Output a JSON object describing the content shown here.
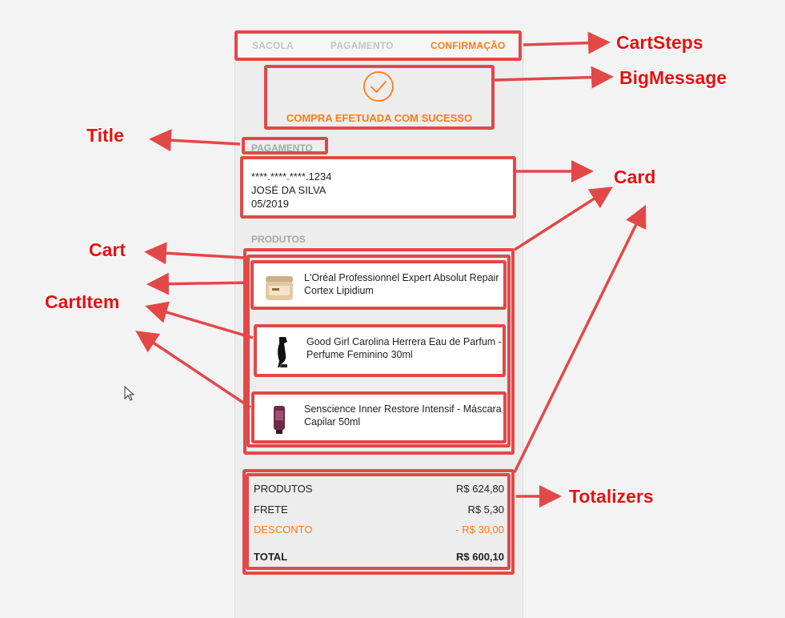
{
  "steps": {
    "sacola": "SACOLA",
    "pagamento": "PAGAMENTO",
    "confirmacao": "CONFIRMAÇÃO"
  },
  "big_message": {
    "icon": "check-circle-icon",
    "text": "COMPRA EFETUADA COM SUCESSO"
  },
  "payment": {
    "title": "PAGAMENTO",
    "card_number": "****.****.****.1234",
    "holder": "JOSÉ DA SILVA",
    "expiry": "05/2019"
  },
  "products": {
    "title": "PRODUTOS",
    "items": [
      {
        "name": "L'Oréal Professionnel Expert Absolut Repair Cortex Lipidium",
        "icon": "cream-jar-icon"
      },
      {
        "name": "Good Girl Carolina Herrera Eau de Parfum - Perfume Feminino 30ml",
        "icon": "perfume-shoe-icon"
      },
      {
        "name": "Senscience Inner Restore Intensif - Máscara Capilar 50ml",
        "icon": "tube-icon"
      }
    ]
  },
  "totals": {
    "produtos_label": "PRODUTOS",
    "produtos_value": "R$ 624,80",
    "frete_label": "FRETE",
    "frete_value": "R$ 5,30",
    "desconto_label": "DESCONTO",
    "desconto_value": "- R$ 30,00",
    "total_label": "TOTAL",
    "total_value": "R$ 600,10"
  },
  "annotations": {
    "cart_steps": "CartSteps",
    "big_message": "BigMessage",
    "title": "Title",
    "card": "Card",
    "cart": "Cart",
    "cart_item": "CartItem",
    "totalizers": "Totalizers"
  },
  "colors": {
    "accent": "#ff7a1a",
    "annotation": "#e24848",
    "annotation_text": "#e81010"
  }
}
